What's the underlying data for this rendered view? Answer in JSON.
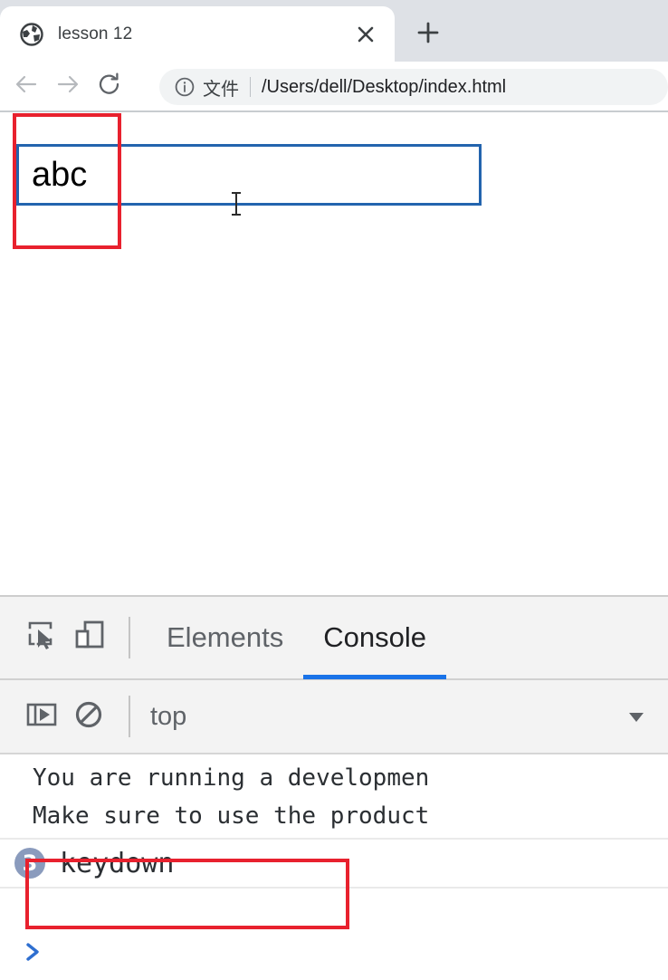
{
  "browser": {
    "tab": {
      "title": "lesson 12",
      "favicon_icon": "globe-icon",
      "close_icon": "close-icon"
    },
    "new_tab_icon": "plus-icon",
    "nav": {
      "back_icon": "arrow-left-icon",
      "forward_icon": "arrow-right-icon",
      "reload_icon": "reload-icon"
    },
    "omnibox": {
      "info_icon": "info-circle-icon",
      "scheme_label": "文件",
      "url": "/Users/dell/Desktop/index.html"
    }
  },
  "page": {
    "input": {
      "value": "abc",
      "placeholder": ""
    },
    "cursor_icon": "text-ibeam-cursor"
  },
  "devtools": {
    "toolbar": {
      "inspect_icon": "inspect-element-icon",
      "device_toggle_icon": "device-toolbar-icon"
    },
    "tabs": [
      {
        "label": "Elements",
        "active": false
      },
      {
        "label": "Console",
        "active": true
      }
    ],
    "subbar": {
      "sidebar_toggle_icon": "console-sidebar-icon",
      "clear_console_icon": "clear-console-icon",
      "context_value": "top",
      "dropdown_icon": "chevron-down-icon"
    },
    "console": {
      "warning_lines": [
        "You are running a developmen",
        "Make sure to use the product"
      ],
      "entries": [
        {
          "count": "3",
          "message": "keydown"
        }
      ],
      "prompt_icon": "prompt-chevron-icon",
      "prompt_value": ""
    }
  },
  "annotations": {
    "accent_color": "#e8212e",
    "input_highlight_label": "",
    "console_highlight_label": ""
  },
  "colors": {
    "tabstrip_bg": "#dee1e6",
    "omnibox_bg": "#f1f3f4",
    "devtools_bg": "#f3f3f3",
    "active_tab_underline": "#1a73e8",
    "input_focus_border": "#2364ae",
    "badge_bg": "#8a9bbd",
    "prompt_blue": "#2f6fd0"
  }
}
